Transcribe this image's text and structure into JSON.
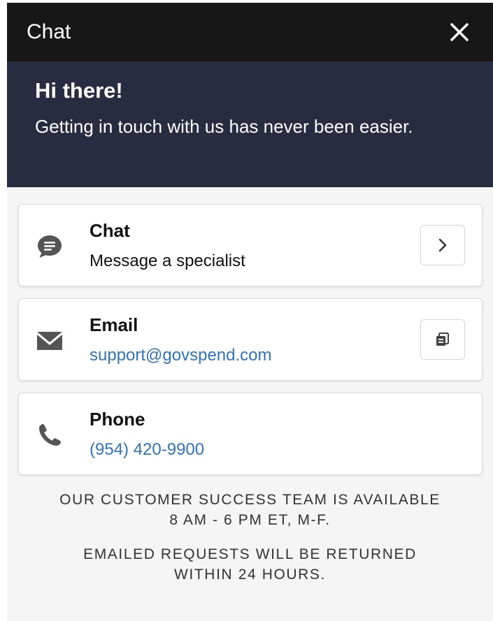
{
  "header": {
    "title": "Chat",
    "close_icon": "close-icon"
  },
  "hero": {
    "title": "Hi there!",
    "subtitle": "Getting in touch with us has never been easier."
  },
  "options": {
    "chat": {
      "title": "Chat",
      "subtitle": "Message a specialist",
      "icon": "chat-bubble-icon",
      "action_icon": "chevron-right-icon"
    },
    "email": {
      "title": "Email",
      "address": "support@govspend.com",
      "icon": "envelope-icon",
      "action_icon": "copy-icon"
    },
    "phone": {
      "title": "Phone",
      "number": "(954) 420-9900",
      "icon": "phone-icon"
    }
  },
  "footer": {
    "hours": "OUR CUSTOMER SUCCESS TEAM IS AVAILABLE 8 AM - 6 PM ET, M-F.",
    "response": "EMAILED REQUESTS WILL BE RETURNED WITHIN 24 HOURS."
  },
  "colors": {
    "topbar": "#171717",
    "hero": "#282c40",
    "link": "#2f74c0",
    "icon": "#555555"
  }
}
